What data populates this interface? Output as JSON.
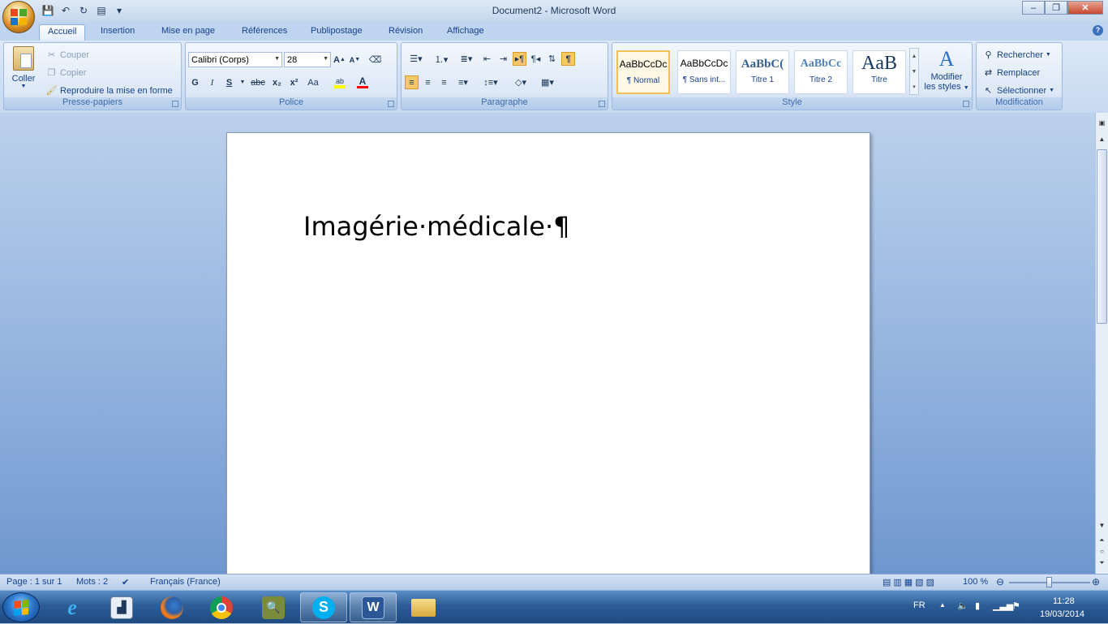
{
  "title_bar": {
    "title": "Document2 - Microsoft Word",
    "minimize_symbol": "–",
    "maximize_symbol": "❐",
    "close_symbol": "✕"
  },
  "tabs": [
    "Accueil",
    "Insertion",
    "Mise en page",
    "Références",
    "Publipostage",
    "Révision",
    "Affichage"
  ],
  "active_tab": "Accueil",
  "clipboard": {
    "label": "Presse-papiers",
    "paste": "Coller",
    "cut": "Couper",
    "copy": "Copier",
    "format_painter": "Reproduire la mise en forme"
  },
  "font": {
    "label": "Police",
    "font_name": "Calibri (Corps)",
    "font_size": "28",
    "bold": "G",
    "italic": "I",
    "underline": "S",
    "strike": "abc",
    "subscript": "x₂",
    "superscript": "x²",
    "case": "Aa",
    "grow": "A",
    "shrink": "A",
    "highlight": "ab",
    "color": "A"
  },
  "paragraph": {
    "label": "Paragraphe",
    "show_marks": "¶"
  },
  "styles": {
    "label": "Style",
    "items": [
      {
        "sample": "AaBbCcDc",
        "name": "¶ Normal"
      },
      {
        "sample": "AaBbCcDc",
        "name": "¶ Sans int..."
      },
      {
        "sample": "AaBbC(",
        "name": "Titre 1"
      },
      {
        "sample": "AaBbCc",
        "name": "Titre 2"
      },
      {
        "sample": "AaB",
        "name": "Titre"
      }
    ],
    "change_styles_line1": "Modifier",
    "change_styles_line2": "les styles"
  },
  "editing": {
    "label": "Modification",
    "find": "Rechercher",
    "replace": "Remplacer",
    "select": "Sélectionner"
  },
  "document": {
    "text": "Imagérie·médicale·¶"
  },
  "status_bar": {
    "page": "Page : 1 sur 1",
    "words": "Mots : 2",
    "language": "Français (France)",
    "zoom": "100 %",
    "zoom_fraction": 0.5
  },
  "taskbar": {
    "lang": "FR",
    "time": "11:28",
    "date": "19/03/2014"
  },
  "colors": {
    "accent": "#15428b",
    "highlight_yellow": "#ffff00",
    "font_red": "#ff0000"
  }
}
